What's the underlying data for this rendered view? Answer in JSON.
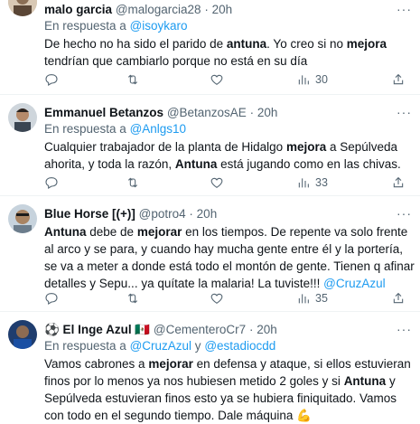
{
  "tweets": [
    {
      "name": "malo garcia",
      "handle": "@malogarcia28",
      "dot": "·",
      "time": "20h",
      "reply_prefix": "En respuesta a ",
      "reply_to": "@isoykaro",
      "reply_and": "",
      "reply_to2": "",
      "views": "30"
    },
    {
      "name": "Emmanuel Betanzos",
      "handle": "@BetanzosAE",
      "dot": "·",
      "time": "20h",
      "reply_prefix": "En respuesta a ",
      "reply_to": "@Anlgs10",
      "views": "33"
    },
    {
      "name": "Blue Horse [(+)]",
      "handle": "@potro4",
      "dot": "·",
      "time": "20h",
      "views": "35"
    },
    {
      "name": "⚽ El Inge Azul",
      "flag": "🇲🇽",
      "handle": "@CementeroCr7",
      "dot": "·",
      "time": "20h",
      "reply_prefix": "En respuesta a ",
      "reply_to": "@CruzAzul",
      "reply_and": " y ",
      "reply_to2": "@estadiocdd"
    }
  ],
  "bodies": {
    "t1": {
      "a": "De hecho no ha sido el parido de ",
      "b1": "antuna",
      "c": ". Yo creo si no ",
      "b2": "mejora",
      "d": " tendrían que cambiarlo porque no está en su día"
    },
    "t2": {
      "a": "Cualquier trabajador de la planta de Hidalgo ",
      "b1": "mejora",
      "c": " a Sepúlveda ahorita, y toda la razón, ",
      "b2": "Antuna",
      "d": " está jugando como en las chivas."
    },
    "t3": {
      "b1": "Antuna",
      "a": " debe de ",
      "b2": "mejorar",
      "c": " en los tiempos. De repente va solo frente al arco y se para, y cuando hay mucha gente entre él y la portería, se va a meter a donde está todo el montón de gente. Tienen q afinar detalles y Sepu... ya quítate la malaria! La tuviste!!! ",
      "m": "@CruzAzul"
    },
    "t4": {
      "a": "Vamos cabrones a ",
      "b1": "mejorar",
      "c": " en defensa y ataque, si ellos estuvieran finos por lo menos ya nos hubiesen metido 2 goles y si ",
      "b2": "Antuna",
      "d": " y Sepúlveda estuvieran finos esto ya se hubiera finiquitado. Vamos con todo en el segundo tiempo. Dale máquina ",
      "emoji": "💪"
    }
  },
  "more_glyph": "···"
}
